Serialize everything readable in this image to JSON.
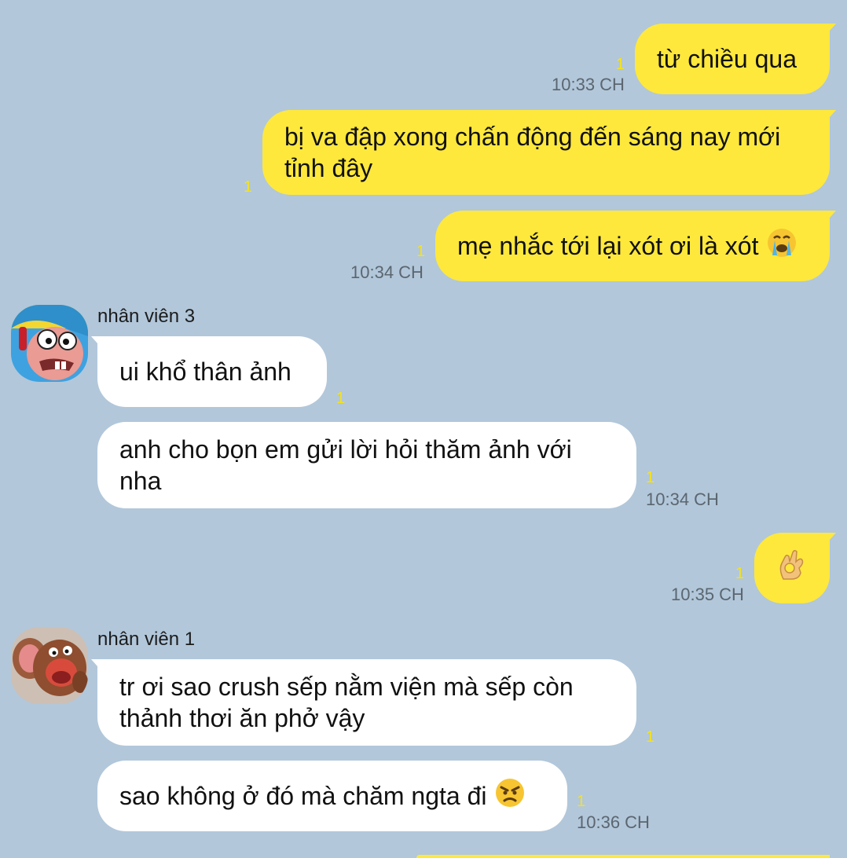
{
  "theme": {
    "background": "#b2c7da",
    "outgoing_bubble": "#fee83c",
    "incoming_bubble": "#ffffff",
    "unread_color": "#f5e21a"
  },
  "messages": [
    {
      "side": "out",
      "text": "từ chiều qua",
      "unread": "1",
      "time": "10:33 CH"
    },
    {
      "side": "out",
      "text": "bị va đập xong chấn động đến sáng nay mới tỉnh đây",
      "unread": "1"
    },
    {
      "side": "out",
      "text": "mẹ nhắc tới lại xót ơi là xót",
      "emoji": "crying-face-emoji",
      "unread": "1",
      "time": "10:34 CH"
    },
    {
      "side": "in",
      "sender": "nhân viên 3",
      "avatar": "cartoon-avatar-1",
      "text": "ui khổ thân ảnh",
      "unread": "1"
    },
    {
      "side": "in",
      "text": "anh cho bọn em gửi lời hỏi thăm ảnh với nha",
      "unread": "1",
      "time": "10:34 CH"
    },
    {
      "side": "out",
      "emoji": "ok-hand-emoji",
      "unread": "1",
      "time": "10:35 CH"
    },
    {
      "side": "in",
      "sender": "nhân viên 1",
      "avatar": "cartoon-avatar-2",
      "text": "tr ơi sao crush sếp nằm viện mà sếp còn thảnh thơi ăn phở vậy",
      "unread": "1"
    },
    {
      "side": "in",
      "text": "sao không ở đó mà chăm ngta đi",
      "emoji": "angry-face-emoji",
      "unread": "1",
      "time": "10:36 CH"
    }
  ]
}
